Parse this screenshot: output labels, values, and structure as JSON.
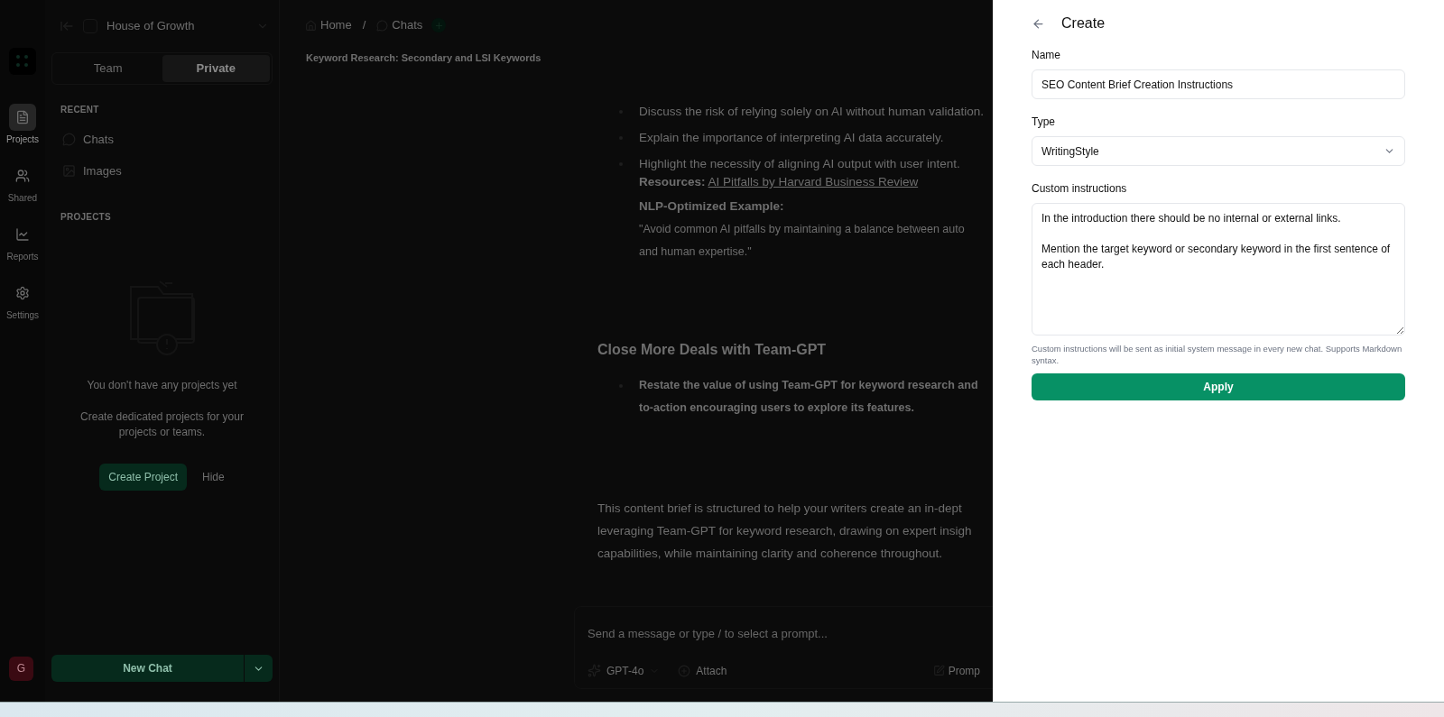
{
  "rail": {
    "items": [
      {
        "label": "Projects",
        "kind": "file",
        "selected": true
      },
      {
        "label": "Shared",
        "kind": "users",
        "selected": false
      },
      {
        "label": "Reports",
        "kind": "chart",
        "selected": false
      },
      {
        "label": "Settings",
        "kind": "gear",
        "selected": false
      }
    ]
  },
  "sidebar": {
    "workspace": "House of Growth",
    "tabs": [
      {
        "label": "Team",
        "selected": false
      },
      {
        "label": "Private",
        "selected": true
      }
    ],
    "recent_heading": "RECENT",
    "recent": [
      {
        "label": "Chats",
        "kind": "chat"
      },
      {
        "label": "Images",
        "kind": "image"
      }
    ],
    "projects_heading": "PROJECTS",
    "empty_title": "You don't have any projects yet",
    "empty_text": "Create dedicated projects for your projects or teams.",
    "create_button": "Create Project",
    "hide_button": "Hide",
    "new_chat_button": "New Chat",
    "avatar": "G"
  },
  "breadcrumb": [
    {
      "label": "Home",
      "kind": "home"
    },
    {
      "label": "Chats",
      "kind": "chat"
    }
  ],
  "breadcrumb_separator": "/",
  "chat_title": "Keyword Research: Secondary and LSI Keywords",
  "content": [
    {
      "kind": "bullet",
      "lines": [
        "Discuss the risk of relying solely on AI without human validation."
      ]
    },
    {
      "kind": "bullet",
      "lines": [
        "Explain the importance of interpreting AI data accurately."
      ]
    },
    {
      "kind": "bullet",
      "lines": [
        "Highlight the necessity of aligning AI output with user intent."
      ]
    },
    {
      "kind": "resource",
      "label": "Resources:",
      "link": "AI Pitfalls by Harvard Business Review"
    },
    {
      "kind": "bold",
      "lines": [
        "NLP-Optimized Example:"
      ]
    },
    {
      "kind": "quote",
      "lines": [
        "\"Avoid common AI pitfalls by maintaining a balance between auto",
        "and human expertise.\""
      ]
    },
    {
      "kind": "heading",
      "lines": [
        "Close More Deals with Team-GPT"
      ]
    },
    {
      "kind": "bold_bullet",
      "lines": [
        "Restate the value of using Team-GPT for keyword research and",
        "to-action encouraging users to explore its features."
      ]
    },
    {
      "kind": "paragraph",
      "lines": [
        "This content brief is structured to help your writers create an in-dept",
        "leveraging Team-GPT for keyword research, drawing on expert insigh",
        "capabilities, while maintaining clarity and coherence throughout."
      ]
    }
  ],
  "composer": {
    "placeholder": "Send a message or type / to select a prompt...",
    "model": "GPT-4o",
    "attach": "Attach",
    "prompts": "Promp"
  },
  "drawer": {
    "title": "Create",
    "name_label": "Name",
    "name_value": "SEO Content Brief Creation Instructions",
    "type_label": "Type",
    "type_value": "WritingStyle",
    "instructions_label": "Custom instructions",
    "instructions_value": "In the introduction there should be no internal or external links.\n\nMention the target keyword or secondary keyword in the first sentence of each header.",
    "help": "Custom instructions will be sent as initial system message in every new chat. Supports Markdown syntax.",
    "apply": "Apply"
  }
}
